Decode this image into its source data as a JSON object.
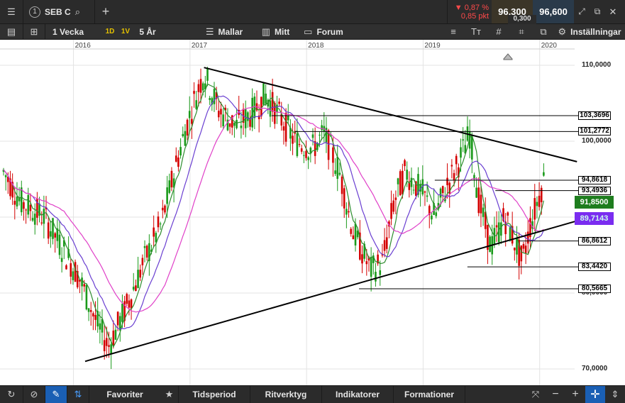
{
  "header": {
    "symbol_number": "1",
    "symbol": "SEB C",
    "change_pct": "0,87 %",
    "change_pts": "0,85 pkt",
    "bid": "96,300",
    "ask": "96,600",
    "spread": "0,300"
  },
  "toolbar": {
    "interval": "1 Vecka",
    "btn_1d": "1D",
    "btn_1v": "1V",
    "range": "5 År",
    "templates": "Mallar",
    "mine": "Mitt",
    "forum": "Forum",
    "settings": "Inställningar"
  },
  "bottombar": {
    "favorites": "Favoriter",
    "time_period": "Tidsperiod",
    "draw_tools": "Ritverktyg",
    "indicators": "Indikatorer",
    "formations": "Formationer"
  },
  "chart_data": {
    "type": "candlestick",
    "x_ticks": [
      "2016",
      "2017",
      "2018",
      "2019",
      "2020"
    ],
    "y_ticks": [
      "110,0000",
      "100,0000",
      "90,0000",
      "80,0000",
      "70,0000"
    ],
    "ylim": [
      69,
      112
    ],
    "price_levels": [
      "103,3696",
      "101,2772",
      "94,8618",
      "93,4936",
      "86,8612",
      "83,4420",
      "80,5665"
    ],
    "price_level_values": [
      103.3696,
      101.2772,
      94.8618,
      93.4936,
      86.8612,
      83.442,
      80.5665
    ],
    "last_price": "91,8500",
    "ma_value": "89,7143",
    "colors": {
      "up": "#1a9a1a",
      "down": "#d40000",
      "ma_fast": "#2d8c2d",
      "ma_mid": "#6a3fd1",
      "ma_slow": "#e040c8",
      "last_price_tag": "#1e7d1e",
      "ma_tag": "#7a2cf0"
    }
  }
}
